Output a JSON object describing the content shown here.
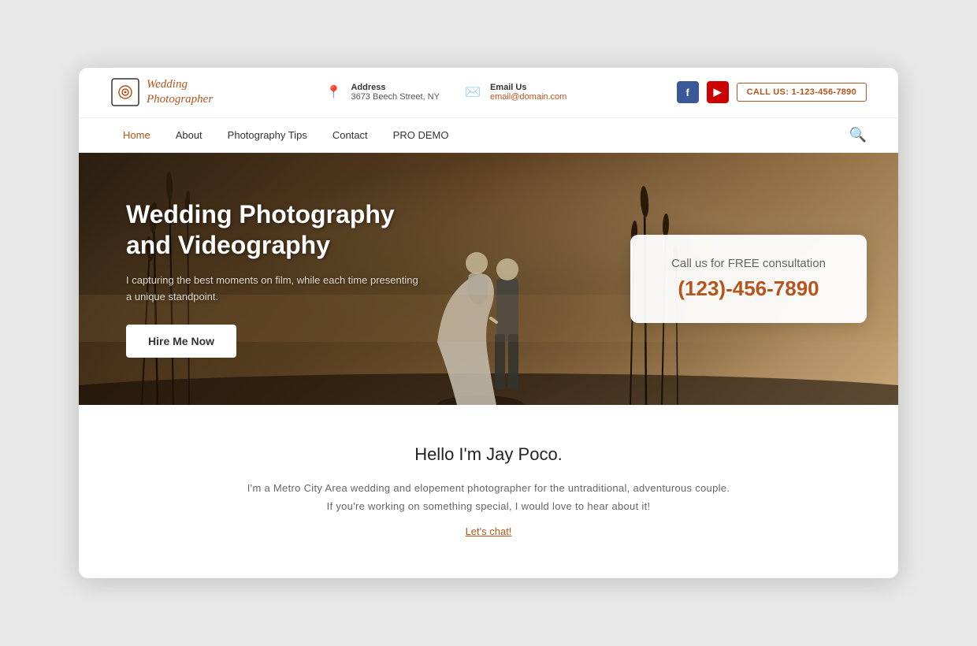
{
  "site": {
    "logo_line1": "Wedding",
    "logo_line2": "Photographer"
  },
  "header": {
    "address_label": "Address",
    "address_value": "3673 Beech Street, NY",
    "email_label": "Email Us",
    "email_value": "email@domain.com",
    "call_btn": "CALL US: 1-123-456-7890"
  },
  "nav": {
    "links": [
      {
        "label": "Home",
        "active": true
      },
      {
        "label": "About",
        "active": false
      },
      {
        "label": "Photography Tips",
        "active": false
      },
      {
        "label": "Contact",
        "active": false
      },
      {
        "label": "PRO DEMO",
        "active": false
      }
    ]
  },
  "hero": {
    "title": "Wedding Photography\nand Videography",
    "subtitle": "I capturing the best moments on film, while each time presenting a unique standpoint.",
    "cta_btn": "Hire Me Now",
    "consult_label": "Call us for FREE consultation",
    "consult_phone": "(123)-456-7890"
  },
  "about": {
    "title": "Hello I'm Jay Poco.",
    "text": "I'm a Metro City Area wedding and elopement photographer for the untraditional, adventurous couple. If you're working on something special, I would love to hear about it!",
    "link": "Let's chat!"
  }
}
